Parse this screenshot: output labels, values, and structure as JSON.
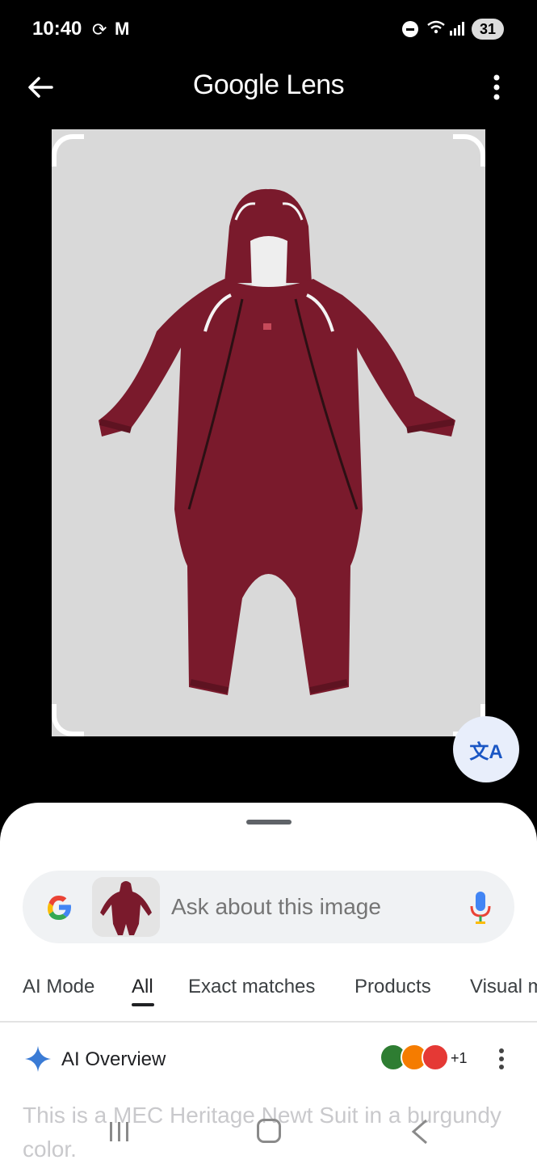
{
  "status_bar": {
    "time": "10:40",
    "battery": "31"
  },
  "app_bar": {
    "title": "Google Lens"
  },
  "search": {
    "placeholder": "Ask about this image"
  },
  "tabs": [
    {
      "label": "AI Mode"
    },
    {
      "label": "All"
    },
    {
      "label": "Exact matches"
    },
    {
      "label": "Products"
    },
    {
      "label": "Visual m"
    }
  ],
  "active_tab": "All",
  "ai_overview": {
    "label": "AI Overview",
    "sources_more": "+1",
    "text": "This is a MEC Heritage Newt Suit in a burgundy color."
  },
  "colors": {
    "suit": "#7a1a2c",
    "accent_blue": "#4285f4",
    "background": "#000000"
  }
}
